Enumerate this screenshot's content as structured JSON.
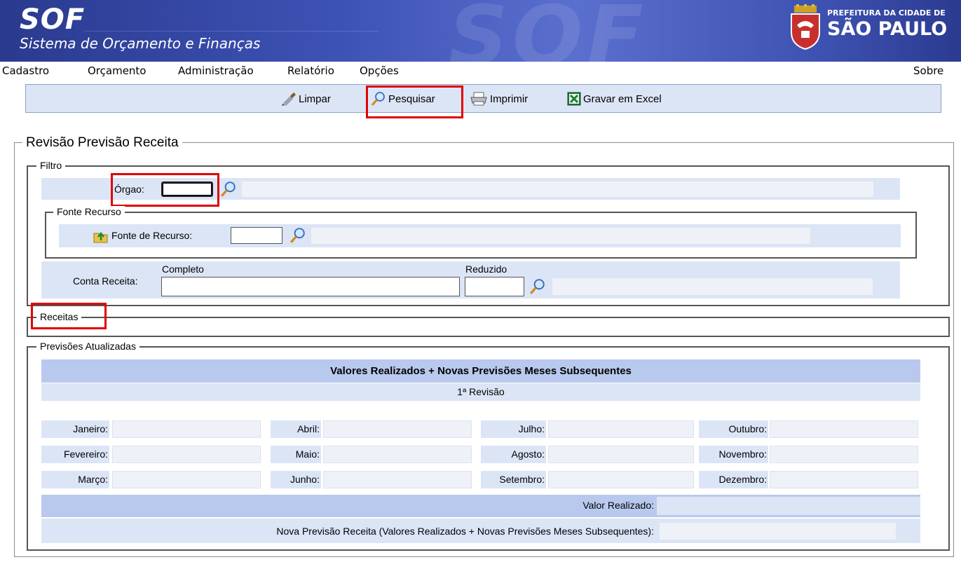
{
  "header": {
    "app_name": "SOF",
    "app_subtitle": "Sistema de Orçamento e Finanças",
    "city_line1": "PREFEITURA DA CIDADE DE",
    "city_line2": "SÃO PAULO"
  },
  "menu": {
    "items": [
      "Cadastro",
      "Orçamento",
      "Administração",
      "Relatório",
      "Opções"
    ],
    "about": "Sobre"
  },
  "toolbar": {
    "limpar": "Limpar",
    "pesquisar": "Pesquisar",
    "imprimir": "Imprimir",
    "gravar_excel": "Gravar em Excel"
  },
  "page": {
    "title": "Revisão Previsão Receita"
  },
  "filtro": {
    "legend": "Filtro",
    "orgao_label": "Órgao:",
    "orgao_value": "",
    "fonte_legend": "Fonte Recurso",
    "fonte_label": "Fonte de Recurso:",
    "fonte_value": "",
    "conta_label": "Conta Receita:",
    "completo_label": "Completo",
    "completo_value": "",
    "reduzido_label": "Reduzido",
    "reduzido_value": ""
  },
  "receitas": {
    "legend": "Receitas"
  },
  "previsoes": {
    "legend": "Previsões Atualizadas",
    "header": "Valores Realizados + Novas Previsões Meses Subsequentes",
    "revision": "1ª Revisão",
    "months": {
      "janeiro": "Janeiro:",
      "fevereiro": "Fevereiro:",
      "marco": "Março:",
      "abril": "Abril:",
      "maio": "Maio:",
      "junho": "Junho:",
      "julho": "Julho:",
      "agosto": "Agosto:",
      "setembro": "Setembro:",
      "outubro": "Outubro:",
      "novembro": "Novembro:",
      "dezembro": "Dezembro:"
    },
    "valor_realizado_label": "Valor Realizado:",
    "nova_previsao_label": "Nova Previsão Receita (Valores Realizados + Novas Previsões Meses Subsequentes):"
  },
  "colors": {
    "header_blue": "#3d52b5",
    "band_light": "#dbe5f6",
    "band_header": "#b9c9ee",
    "highlight_red": "#e00000"
  }
}
